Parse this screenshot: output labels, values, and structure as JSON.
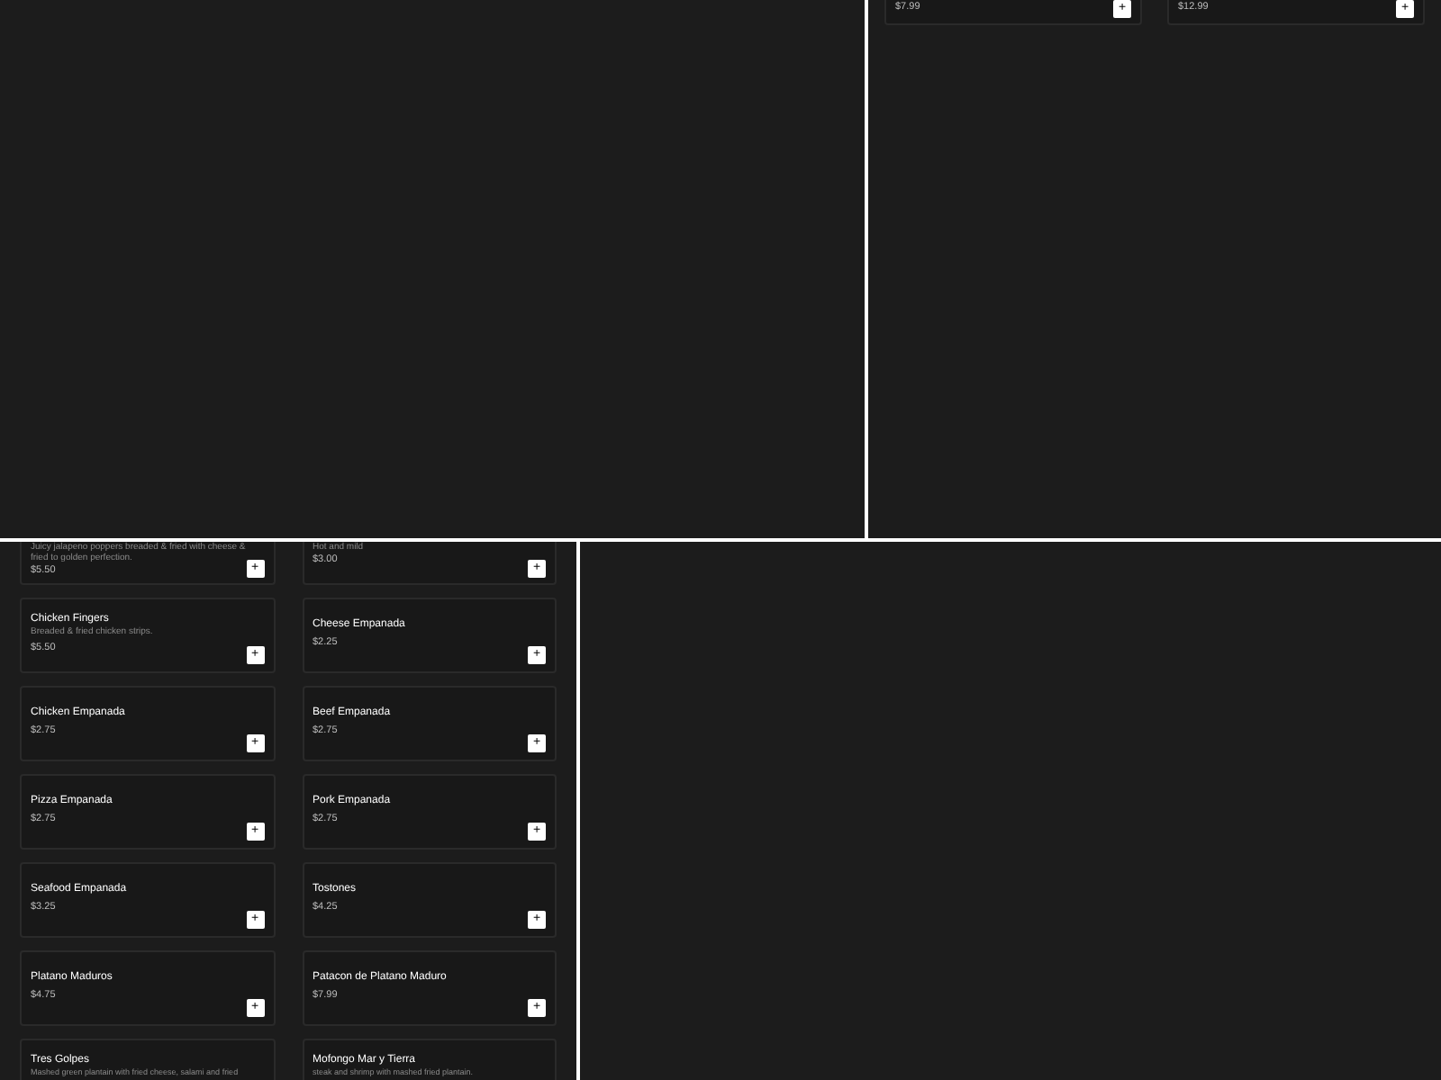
{
  "rows": [
    {
      "panes": [
        {
          "kind": "blank"
        },
        {
          "kind": "menu",
          "items": [
            {
              "price": "$7.99",
              "button": "+"
            },
            {
              "price": "$12.99",
              "button": "+"
            }
          ]
        }
      ]
    },
    {
      "panes": [
        {
          "kind": "menu",
          "items": [
            {
              "description": "Juicy jalapeno poppers breaded & fried with cheese & fried to golden perfection.",
              "price": "$5.50",
              "button": "+"
            },
            {
              "description": "Hot and mild",
              "price": "$3.00",
              "button": "+"
            },
            {
              "name": "Chicken Fingers",
              "description": "Breaded & fried chicken strips.",
              "price": "$5.50",
              "button": "+"
            },
            {
              "name": "Cheese Empanada",
              "price": "$2.25",
              "button": "+"
            },
            {
              "name": "Chicken Empanada",
              "price": "$2.75",
              "button": "+"
            },
            {
              "name": "Beef Empanada",
              "price": "$2.75",
              "button": "+"
            },
            {
              "name": "Pizza Empanada",
              "price": "$2.75",
              "button": "+"
            },
            {
              "name": "Pork Empanada",
              "price": "$2.75",
              "button": "+"
            },
            {
              "name": "Seafood Empanada",
              "price": "$3.25",
              "button": "+"
            },
            {
              "name": "Tostones",
              "price": "$4.25",
              "button": "+"
            },
            {
              "name": "Platano Maduros",
              "price": "$4.75",
              "button": "+"
            },
            {
              "name": "Patacon de Platano Maduro",
              "price": "$7.99",
              "button": "+"
            },
            {
              "name": "Tres Golpes",
              "description": "Mashed green plantain with fried cheese, salami and fried"
            },
            {
              "name": "Mofongo Mar y Tierra",
              "description": "steak and shrimp with mashed fried plantain."
            }
          ]
        },
        {
          "kind": "blank"
        }
      ]
    }
  ]
}
